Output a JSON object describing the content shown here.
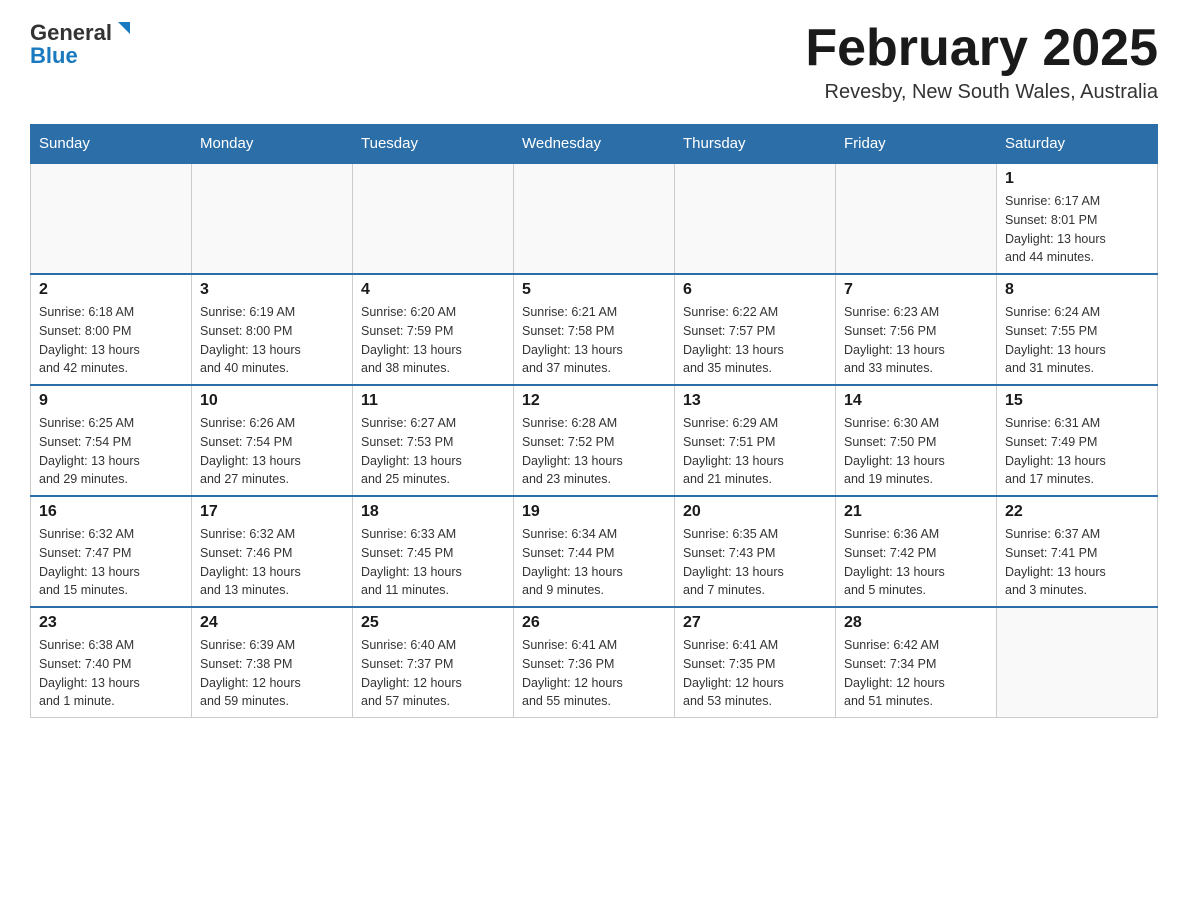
{
  "header": {
    "logo_general": "General",
    "logo_blue": "Blue",
    "month_title": "February 2025",
    "location": "Revesby, New South Wales, Australia"
  },
  "weekdays": [
    "Sunday",
    "Monday",
    "Tuesday",
    "Wednesday",
    "Thursday",
    "Friday",
    "Saturday"
  ],
  "weeks": [
    [
      {
        "day": "",
        "info": ""
      },
      {
        "day": "",
        "info": ""
      },
      {
        "day": "",
        "info": ""
      },
      {
        "day": "",
        "info": ""
      },
      {
        "day": "",
        "info": ""
      },
      {
        "day": "",
        "info": ""
      },
      {
        "day": "1",
        "info": "Sunrise: 6:17 AM\nSunset: 8:01 PM\nDaylight: 13 hours\nand 44 minutes."
      }
    ],
    [
      {
        "day": "2",
        "info": "Sunrise: 6:18 AM\nSunset: 8:00 PM\nDaylight: 13 hours\nand 42 minutes."
      },
      {
        "day": "3",
        "info": "Sunrise: 6:19 AM\nSunset: 8:00 PM\nDaylight: 13 hours\nand 40 minutes."
      },
      {
        "day": "4",
        "info": "Sunrise: 6:20 AM\nSunset: 7:59 PM\nDaylight: 13 hours\nand 38 minutes."
      },
      {
        "day": "5",
        "info": "Sunrise: 6:21 AM\nSunset: 7:58 PM\nDaylight: 13 hours\nand 37 minutes."
      },
      {
        "day": "6",
        "info": "Sunrise: 6:22 AM\nSunset: 7:57 PM\nDaylight: 13 hours\nand 35 minutes."
      },
      {
        "day": "7",
        "info": "Sunrise: 6:23 AM\nSunset: 7:56 PM\nDaylight: 13 hours\nand 33 minutes."
      },
      {
        "day": "8",
        "info": "Sunrise: 6:24 AM\nSunset: 7:55 PM\nDaylight: 13 hours\nand 31 minutes."
      }
    ],
    [
      {
        "day": "9",
        "info": "Sunrise: 6:25 AM\nSunset: 7:54 PM\nDaylight: 13 hours\nand 29 minutes."
      },
      {
        "day": "10",
        "info": "Sunrise: 6:26 AM\nSunset: 7:54 PM\nDaylight: 13 hours\nand 27 minutes."
      },
      {
        "day": "11",
        "info": "Sunrise: 6:27 AM\nSunset: 7:53 PM\nDaylight: 13 hours\nand 25 minutes."
      },
      {
        "day": "12",
        "info": "Sunrise: 6:28 AM\nSunset: 7:52 PM\nDaylight: 13 hours\nand 23 minutes."
      },
      {
        "day": "13",
        "info": "Sunrise: 6:29 AM\nSunset: 7:51 PM\nDaylight: 13 hours\nand 21 minutes."
      },
      {
        "day": "14",
        "info": "Sunrise: 6:30 AM\nSunset: 7:50 PM\nDaylight: 13 hours\nand 19 minutes."
      },
      {
        "day": "15",
        "info": "Sunrise: 6:31 AM\nSunset: 7:49 PM\nDaylight: 13 hours\nand 17 minutes."
      }
    ],
    [
      {
        "day": "16",
        "info": "Sunrise: 6:32 AM\nSunset: 7:47 PM\nDaylight: 13 hours\nand 15 minutes."
      },
      {
        "day": "17",
        "info": "Sunrise: 6:32 AM\nSunset: 7:46 PM\nDaylight: 13 hours\nand 13 minutes."
      },
      {
        "day": "18",
        "info": "Sunrise: 6:33 AM\nSunset: 7:45 PM\nDaylight: 13 hours\nand 11 minutes."
      },
      {
        "day": "19",
        "info": "Sunrise: 6:34 AM\nSunset: 7:44 PM\nDaylight: 13 hours\nand 9 minutes."
      },
      {
        "day": "20",
        "info": "Sunrise: 6:35 AM\nSunset: 7:43 PM\nDaylight: 13 hours\nand 7 minutes."
      },
      {
        "day": "21",
        "info": "Sunrise: 6:36 AM\nSunset: 7:42 PM\nDaylight: 13 hours\nand 5 minutes."
      },
      {
        "day": "22",
        "info": "Sunrise: 6:37 AM\nSunset: 7:41 PM\nDaylight: 13 hours\nand 3 minutes."
      }
    ],
    [
      {
        "day": "23",
        "info": "Sunrise: 6:38 AM\nSunset: 7:40 PM\nDaylight: 13 hours\nand 1 minute."
      },
      {
        "day": "24",
        "info": "Sunrise: 6:39 AM\nSunset: 7:38 PM\nDaylight: 12 hours\nand 59 minutes."
      },
      {
        "day": "25",
        "info": "Sunrise: 6:40 AM\nSunset: 7:37 PM\nDaylight: 12 hours\nand 57 minutes."
      },
      {
        "day": "26",
        "info": "Sunrise: 6:41 AM\nSunset: 7:36 PM\nDaylight: 12 hours\nand 55 minutes."
      },
      {
        "day": "27",
        "info": "Sunrise: 6:41 AM\nSunset: 7:35 PM\nDaylight: 12 hours\nand 53 minutes."
      },
      {
        "day": "28",
        "info": "Sunrise: 6:42 AM\nSunset: 7:34 PM\nDaylight: 12 hours\nand 51 minutes."
      },
      {
        "day": "",
        "info": ""
      }
    ]
  ]
}
